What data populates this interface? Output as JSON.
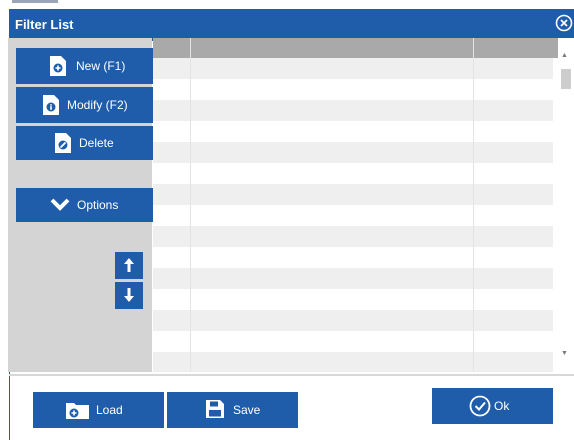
{
  "window": {
    "title": "Filter List",
    "close_icon": "close-circle-icon"
  },
  "toolbar": {
    "new_label": "New (F1)",
    "modify_label": "Modify (F2)",
    "delete_label": "Delete",
    "options_label": "Options",
    "new_icon": "new-document-icon",
    "modify_icon": "modify-document-icon",
    "delete_icon": "delete-document-icon",
    "options_icon": "chevron-down-icon",
    "move_up_icon": "arrow-up-icon",
    "move_down_icon": "arrow-down-icon"
  },
  "grid": {
    "columns": [
      "",
      "",
      ""
    ],
    "rows": []
  },
  "footer": {
    "load_label": "Load",
    "save_label": "Save",
    "ok_label": "Ok",
    "load_icon": "folder-open-icon",
    "save_icon": "floppy-disk-icon",
    "ok_icon": "check-circle-icon"
  },
  "colors": {
    "accent": "#1f5dab",
    "panel": "#d4d4d4",
    "grid_header": "#a9a9a9",
    "row_alt": "#efefef"
  }
}
